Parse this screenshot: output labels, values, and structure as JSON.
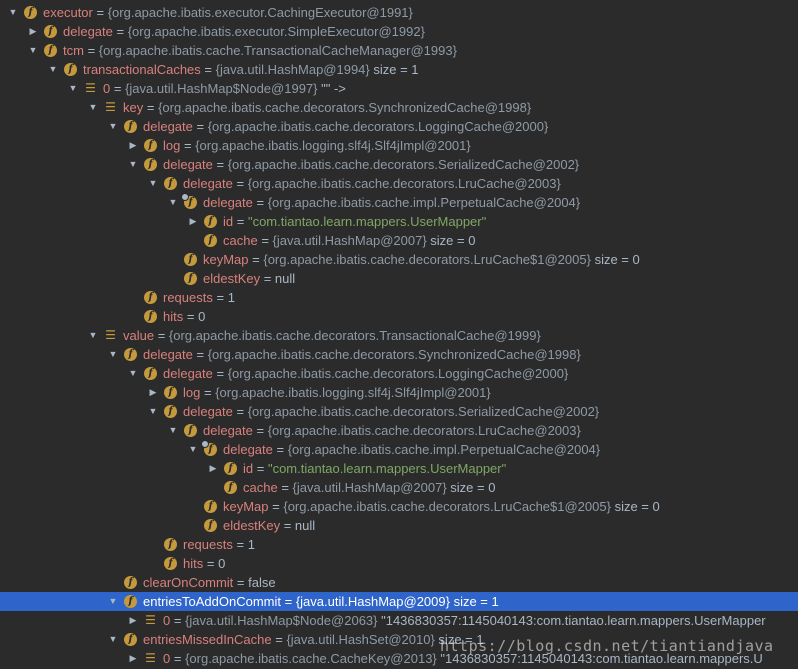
{
  "rows": [
    {
      "depth": 0,
      "expanded": true,
      "icon": "field-icon",
      "name": "executor",
      "value": "{org.apache.ibatis.executor.CachingExecutor@1991}",
      "extra": ""
    },
    {
      "depth": 1,
      "expanded": false,
      "icon": "field-icon",
      "name": "delegate",
      "value": "{org.apache.ibatis.executor.SimpleExecutor@1992}",
      "extra": ""
    },
    {
      "depth": 1,
      "expanded": true,
      "icon": "field-icon",
      "name": "tcm",
      "value": "{org.apache.ibatis.cache.TransactionalCacheManager@1993}",
      "extra": ""
    },
    {
      "depth": 2,
      "expanded": true,
      "icon": "field-icon",
      "name": "transactionalCaches",
      "value": "{java.util.HashMap@1994}",
      "extra": " size = 1"
    },
    {
      "depth": 3,
      "expanded": true,
      "icon": "list-icon",
      "name": "0",
      "value": "{java.util.HashMap$Node@1997}",
      "extra": " \"\" ->"
    },
    {
      "depth": 4,
      "expanded": true,
      "icon": "list-icon",
      "name": "key",
      "value": "{org.apache.ibatis.cache.decorators.SynchronizedCache@1998}",
      "extra": ""
    },
    {
      "depth": 5,
      "expanded": true,
      "icon": "field-icon",
      "name": "delegate",
      "value": "{org.apache.ibatis.cache.decorators.LoggingCache@2000}",
      "extra": ""
    },
    {
      "depth": 6,
      "expanded": false,
      "icon": "field-icon",
      "name": "log",
      "value": "{org.apache.ibatis.logging.slf4j.Slf4jImpl@2001}",
      "extra": ""
    },
    {
      "depth": 6,
      "expanded": true,
      "icon": "field-icon",
      "name": "delegate",
      "value": "{org.apache.ibatis.cache.decorators.SerializedCache@2002}",
      "extra": ""
    },
    {
      "depth": 7,
      "expanded": true,
      "icon": "field-icon",
      "name": "delegate",
      "value": "{org.apache.ibatis.cache.decorators.LruCache@2003}",
      "extra": ""
    },
    {
      "depth": 8,
      "expanded": true,
      "icon": "field-icon-marked",
      "name": "delegate",
      "value": "{org.apache.ibatis.cache.impl.PerpetualCache@2004}",
      "extra": ""
    },
    {
      "depth": 9,
      "expanded": false,
      "icon": "field-icon",
      "name": "id",
      "value": "\"com.tiantao.learn.mappers.UserMapper\"",
      "extra": "",
      "string": true
    },
    {
      "depth": 9,
      "expanded": null,
      "icon": "field-icon",
      "name": "cache",
      "value": "{java.util.HashMap@2007}",
      "extra": " size = 0"
    },
    {
      "depth": 8,
      "expanded": null,
      "icon": "field-icon",
      "name": "keyMap",
      "value": "{org.apache.ibatis.cache.decorators.LruCache$1@2005}",
      "extra": " size = 0"
    },
    {
      "depth": 8,
      "expanded": null,
      "icon": "field-icon",
      "name": "eldestKey",
      "value": "null",
      "extra": "",
      "plain": true
    },
    {
      "depth": 6,
      "expanded": null,
      "icon": "field-icon",
      "name": "requests",
      "value": "1",
      "extra": "",
      "plain": true
    },
    {
      "depth": 6,
      "expanded": null,
      "icon": "field-icon",
      "name": "hits",
      "value": "0",
      "extra": "",
      "plain": true
    },
    {
      "depth": 4,
      "expanded": true,
      "icon": "list-icon",
      "name": "value",
      "value": "{org.apache.ibatis.cache.decorators.TransactionalCache@1999}",
      "extra": ""
    },
    {
      "depth": 5,
      "expanded": true,
      "icon": "field-icon",
      "name": "delegate",
      "value": "{org.apache.ibatis.cache.decorators.SynchronizedCache@1998}",
      "extra": ""
    },
    {
      "depth": 6,
      "expanded": true,
      "icon": "field-icon",
      "name": "delegate",
      "value": "{org.apache.ibatis.cache.decorators.LoggingCache@2000}",
      "extra": ""
    },
    {
      "depth": 7,
      "expanded": false,
      "icon": "field-icon",
      "name": "log",
      "value": "{org.apache.ibatis.logging.slf4j.Slf4jImpl@2001}",
      "extra": ""
    },
    {
      "depth": 7,
      "expanded": true,
      "icon": "field-icon",
      "name": "delegate",
      "value": "{org.apache.ibatis.cache.decorators.SerializedCache@2002}",
      "extra": ""
    },
    {
      "depth": 8,
      "expanded": true,
      "icon": "field-icon",
      "name": "delegate",
      "value": "{org.apache.ibatis.cache.decorators.LruCache@2003}",
      "extra": ""
    },
    {
      "depth": 9,
      "expanded": true,
      "icon": "field-icon-marked",
      "name": "delegate",
      "value": "{org.apache.ibatis.cache.impl.PerpetualCache@2004}",
      "extra": ""
    },
    {
      "depth": 10,
      "expanded": false,
      "icon": "field-icon",
      "name": "id",
      "value": "\"com.tiantao.learn.mappers.UserMapper\"",
      "extra": "",
      "string": true
    },
    {
      "depth": 10,
      "expanded": null,
      "icon": "field-icon",
      "name": "cache",
      "value": "{java.util.HashMap@2007}",
      "extra": " size = 0"
    },
    {
      "depth": 9,
      "expanded": null,
      "icon": "field-icon",
      "name": "keyMap",
      "value": "{org.apache.ibatis.cache.decorators.LruCache$1@2005}",
      "extra": " size = 0"
    },
    {
      "depth": 9,
      "expanded": null,
      "icon": "field-icon",
      "name": "eldestKey",
      "value": "null",
      "extra": "",
      "plain": true
    },
    {
      "depth": 7,
      "expanded": null,
      "icon": "field-icon",
      "name": "requests",
      "value": "1",
      "extra": "",
      "plain": true
    },
    {
      "depth": 7,
      "expanded": null,
      "icon": "field-icon",
      "name": "hits",
      "value": "0",
      "extra": "",
      "plain": true
    },
    {
      "depth": 5,
      "expanded": null,
      "icon": "field-icon",
      "name": "clearOnCommit",
      "value": "false",
      "extra": "",
      "plain": true
    },
    {
      "depth": 5,
      "expanded": true,
      "icon": "field-icon",
      "name": "entriesToAddOnCommit",
      "value": "{java.util.HashMap@2009}",
      "extra": " size = 1",
      "selected": true
    },
    {
      "depth": 6,
      "expanded": false,
      "icon": "list-icon",
      "name": "0",
      "value": "{java.util.HashMap$Node@2063}",
      "extra": " \"1436830357:1145040143:com.tiantao.learn.mappers.UserMapper"
    },
    {
      "depth": 5,
      "expanded": true,
      "icon": "field-icon",
      "name": "entriesMissedInCache",
      "value": "{java.util.HashSet@2010}",
      "extra": " size = 1"
    },
    {
      "depth": 6,
      "expanded": false,
      "icon": "list-icon",
      "name": "0",
      "value": "{org.apache.ibatis.cache.CacheKey@2013}",
      "extra": " \"1436830357:1145040143:com.tiantao.learn.mappers.U"
    }
  ],
  "watermark": "https://blog.csdn.net/tiantiandjava",
  "colors": {
    "background": "#2b2b2b",
    "selection": "#2f65ca",
    "field_name": "#d8817d",
    "icon": "#c49a3c",
    "string_value": "#7fa765"
  }
}
